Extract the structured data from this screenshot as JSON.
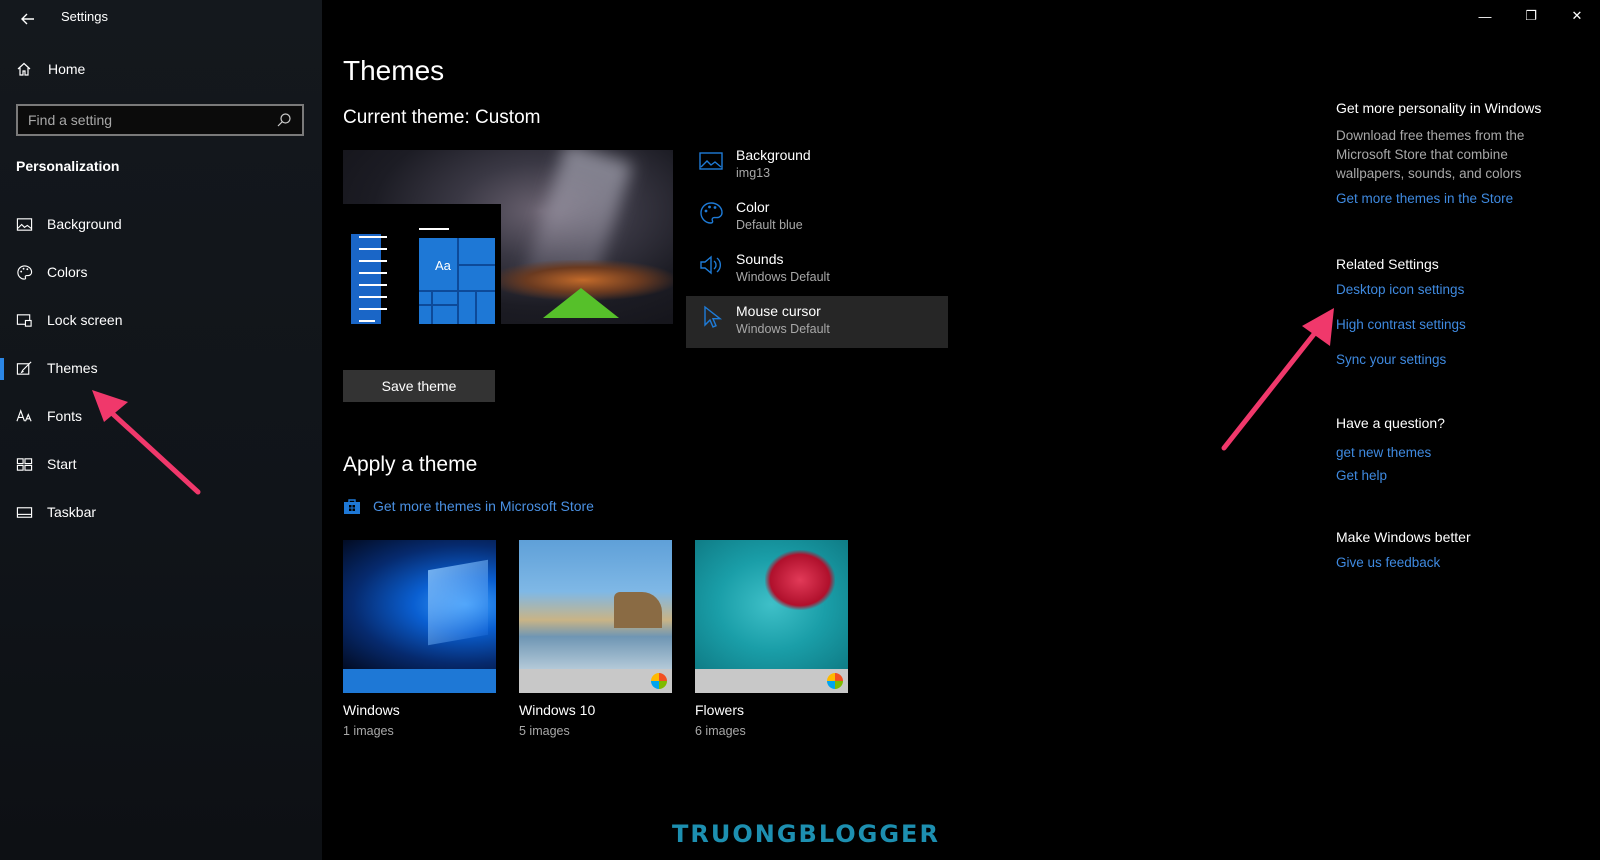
{
  "window": {
    "title": "Settings",
    "controls": {
      "minimize": "—",
      "maximize": "❐",
      "close": "✕"
    }
  },
  "sidebar": {
    "home_label": "Home",
    "search_placeholder": "Find a setting",
    "section": "Personalization",
    "items": [
      {
        "label": "Background",
        "icon": "image-icon",
        "active": false
      },
      {
        "label": "Colors",
        "icon": "palette-icon",
        "active": false
      },
      {
        "label": "Lock screen",
        "icon": "lock-screen-icon",
        "active": false
      },
      {
        "label": "Themes",
        "icon": "themes-icon",
        "active": true
      },
      {
        "label": "Fonts",
        "icon": "fonts-icon",
        "active": false
      },
      {
        "label": "Start",
        "icon": "start-icon",
        "active": false
      },
      {
        "label": "Taskbar",
        "icon": "taskbar-icon",
        "active": false
      }
    ]
  },
  "main": {
    "title": "Themes",
    "current_theme": "Current theme: Custom",
    "preview_tile_text": "Aa",
    "properties": [
      {
        "name": "Background",
        "value": "img13",
        "icon": "image-icon"
      },
      {
        "name": "Color",
        "value": "Default blue",
        "icon": "palette-icon"
      },
      {
        "name": "Sounds",
        "value": "Windows Default",
        "icon": "speaker-icon"
      },
      {
        "name": "Mouse cursor",
        "value": "Windows Default",
        "icon": "cursor-icon"
      }
    ],
    "save_button": "Save theme",
    "apply_title": "Apply a theme",
    "store_link": "Get more themes in Microsoft Store",
    "themes": [
      {
        "name": "Windows",
        "count": "1 images"
      },
      {
        "name": "Windows 10",
        "count": "5 images"
      },
      {
        "name": "Flowers",
        "count": "6 images"
      }
    ]
  },
  "right_panel": {
    "personality_head": "Get more personality in Windows",
    "personality_text": "Download free themes from the Microsoft Store that combine wallpapers, sounds, and colors",
    "personality_link": "Get more themes in the Store",
    "related_head": "Related Settings",
    "related_links": [
      "Desktop icon settings",
      "High contrast settings",
      "Sync your settings"
    ],
    "question_head": "Have a question?",
    "question_links": [
      "get new themes",
      "Get help"
    ],
    "better_head": "Make Windows better",
    "better_link": "Give us feedback"
  },
  "watermark": "TRUONGBLOGGER",
  "colors": {
    "accent": "#1e78d6",
    "link": "#3f8ae0",
    "annotation_arrow": "#f0386b"
  }
}
